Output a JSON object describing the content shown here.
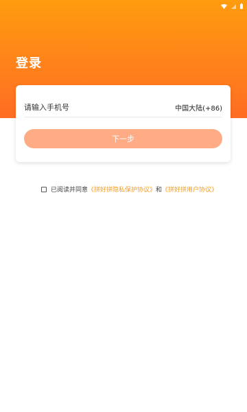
{
  "colors": {
    "header_gradient_top": "#ff9c0f",
    "header_gradient_bottom": "#ff6d23",
    "accent_link": "#f39b1f",
    "button_bg": "#ffab86"
  },
  "status_bar": {
    "icons": [
      "wifi-icon",
      "signal-icon",
      "battery-icon"
    ]
  },
  "header": {
    "title": "登录"
  },
  "login_card": {
    "phone_placeholder": "请输入手机号",
    "phone_value": "",
    "region_label": "中国大陆(+86)",
    "next_button_label": "下一步"
  },
  "agreement": {
    "checked": false,
    "prefix": "已阅读并同意",
    "privacy_link": "《拼好拼隐私保护协议》",
    "conjunction": "和",
    "user_link": "《拼好拼用户协议》"
  }
}
